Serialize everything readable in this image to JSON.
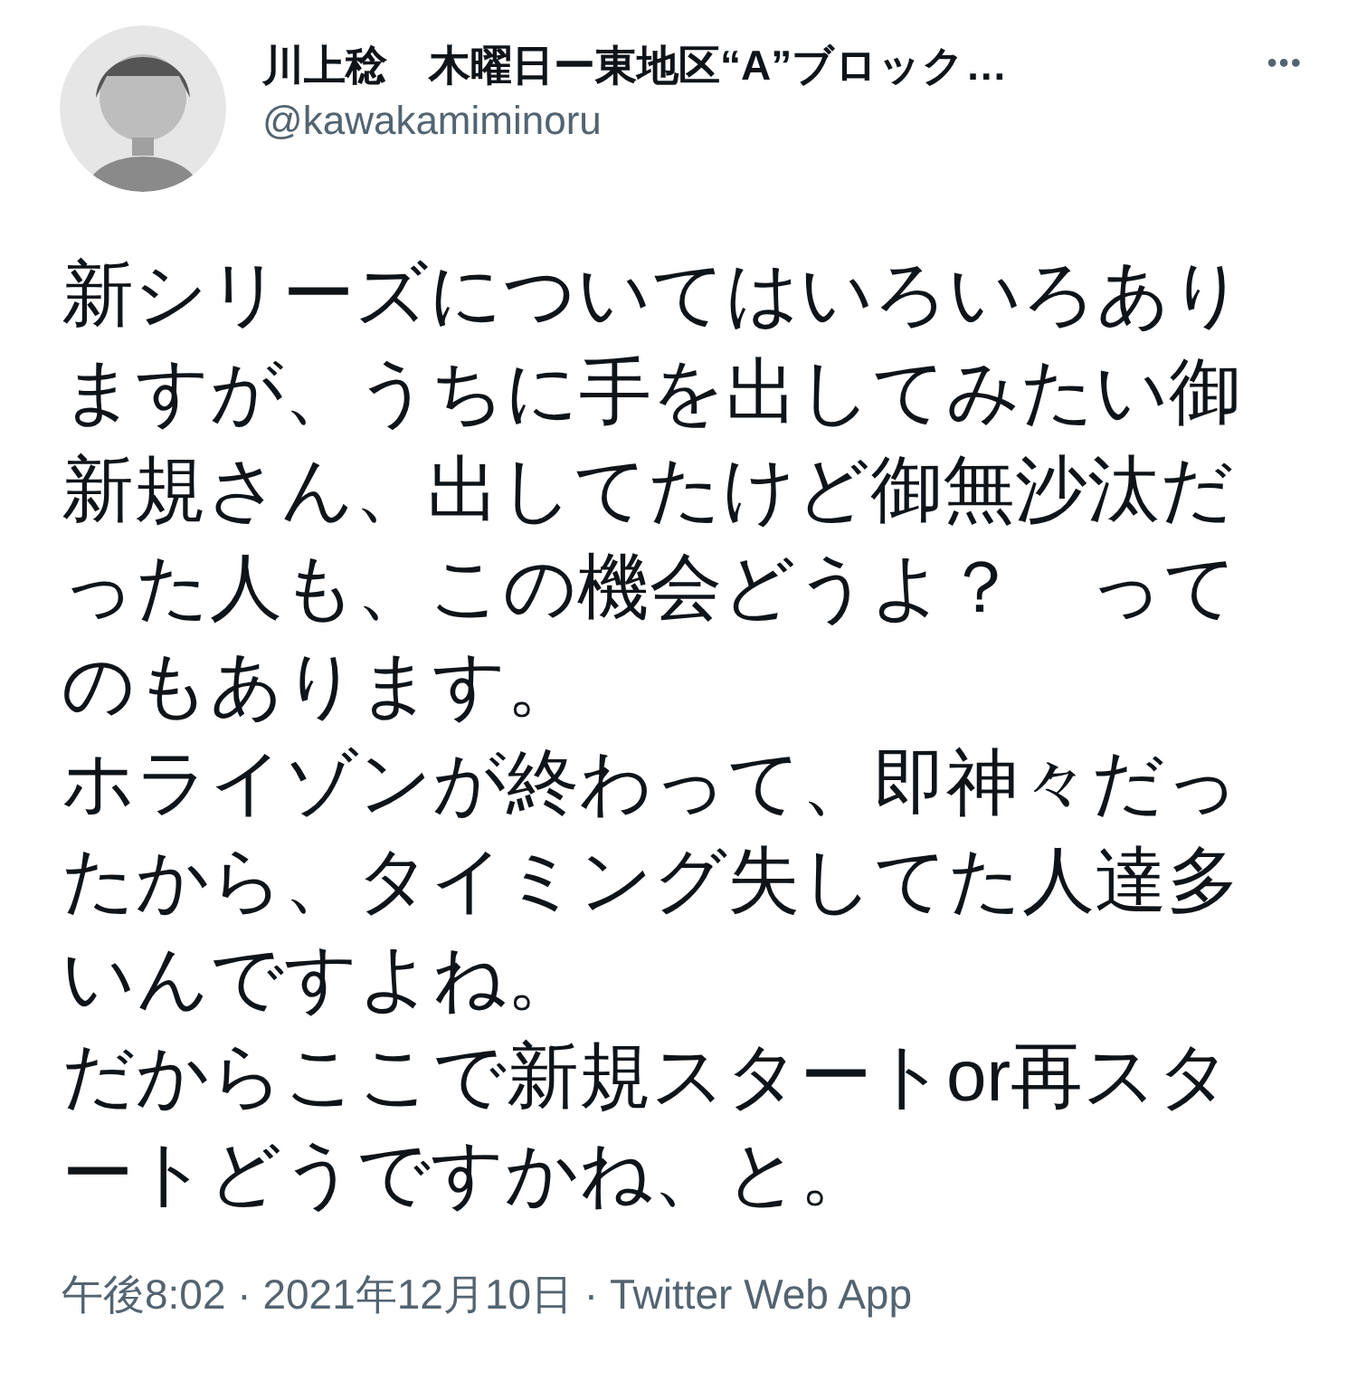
{
  "author": {
    "name": "川上稔　木曜日ー東地区“A”ブロック…",
    "handle": "@kawakamiminoru"
  },
  "more": "•••",
  "body": [
    "新シリーズについてはいろいろありますが、うちに手を出してみたい御新規さん、出してたけど御無沙汰だった人も、この機会どうよ？　ってのもあります。",
    "ホライゾンが終わって、即神々だったから、タイミング失してた人達多いんですよね。",
    "だからここで新規スタートor再スタートどうですかね、と。"
  ],
  "meta": "午後8:02 · 2021年12月10日 · Twitter Web App"
}
